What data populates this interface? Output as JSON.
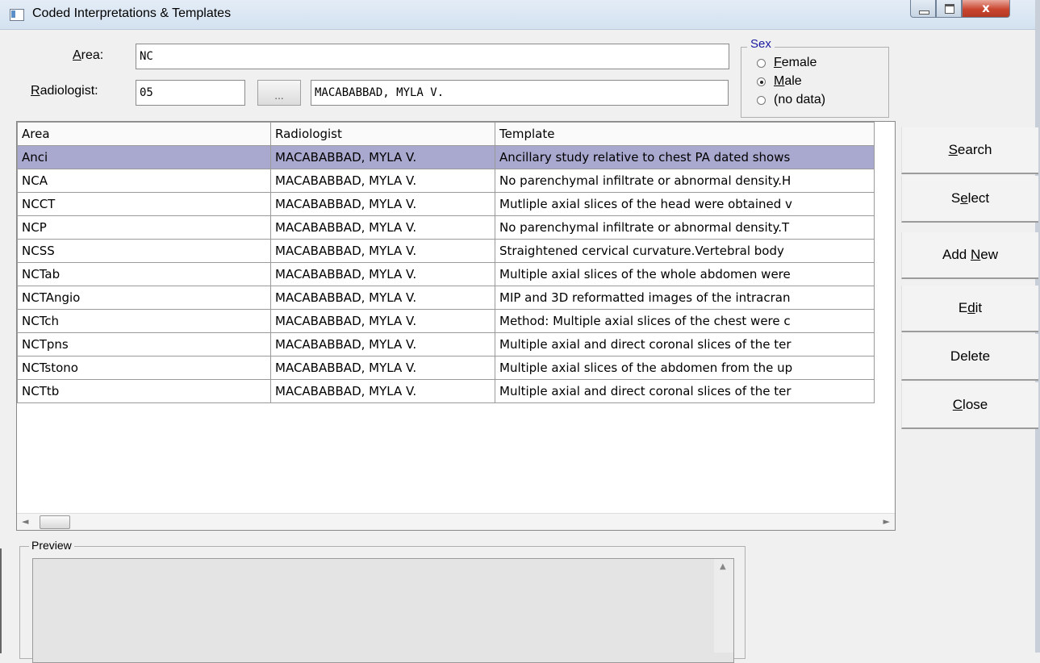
{
  "window": {
    "title": "Coded Interpretations & Templates"
  },
  "form": {
    "area_label_pre": "",
    "area_label_ul": "A",
    "area_label_post": "rea:",
    "area_value": "NC",
    "radiologist_label_ul": "R",
    "radiologist_label_post": "adiologist:",
    "radiologist_code": "05",
    "lookup_label": "...",
    "radiologist_name": "MACABABBAD, MYLA V."
  },
  "sex": {
    "legend": "Sex",
    "options": [
      {
        "ul": "F",
        "rest": "emale",
        "selected": false
      },
      {
        "ul": "M",
        "rest": "ale",
        "selected": true
      },
      {
        "ul": "",
        "rest": "(no data)",
        "selected": false
      }
    ]
  },
  "grid": {
    "headers": [
      "Area",
      "Radiologist",
      "Template"
    ],
    "rows": [
      [
        "Anci",
        "MACABABBAD, MYLA V.",
        "Ancillary study relative to chest PA dated shows"
      ],
      [
        "NCA",
        "MACABABBAD, MYLA V.",
        "No parenchymal infiltrate or abnormal density.H"
      ],
      [
        "NCCT",
        "MACABABBAD, MYLA V.",
        "Mutliple axial slices of the head were obtained v"
      ],
      [
        "NCP",
        "MACABABBAD, MYLA V.",
        "No parenchymal infiltrate or abnormal density.T"
      ],
      [
        "NCSS",
        "MACABABBAD, MYLA V.",
        "Straightened cervical curvature.Vertebral body"
      ],
      [
        "NCTab",
        "MACABABBAD, MYLA V.",
        "Multiple axial slices of the whole abdomen were"
      ],
      [
        "NCTAngio",
        "MACABABBAD, MYLA V.",
        "MIP and 3D reformatted images of the intracran"
      ],
      [
        "NCTch",
        "MACABABBAD, MYLA V.",
        "Method: Multiple axial slices of the chest were c"
      ],
      [
        "NCTpns",
        "MACABABBAD, MYLA V.",
        "Multiple axial and direct coronal slices of the ter"
      ],
      [
        "NCTstono",
        "MACABABBAD, MYLA V.",
        "Multiple axial slices of the abdomen from the up"
      ],
      [
        "NCTtb",
        "MACABABBAD, MYLA V.",
        "Multiple axial and direct coronal slices of the ter"
      ]
    ],
    "selected_row": 0
  },
  "buttons": {
    "search": {
      "ul": "S",
      "rest": "earch",
      "pre": ""
    },
    "select": {
      "pre": "S",
      "ul": "e",
      "rest": "lect"
    },
    "add_new": {
      "pre": "Add ",
      "ul": "N",
      "rest": "ew"
    },
    "edit": {
      "pre": "E",
      "ul": "d",
      "rest": "it"
    },
    "delete": {
      "pre": "Delete",
      "ul": "",
      "rest": ""
    },
    "close": {
      "pre": "",
      "ul": "C",
      "rest": "lose"
    }
  },
  "preview": {
    "legend": "Preview"
  },
  "window_controls": {
    "close_glyph": "x"
  },
  "scroll_glyphs": {
    "left": "◄",
    "right": "►",
    "up": "▲"
  }
}
